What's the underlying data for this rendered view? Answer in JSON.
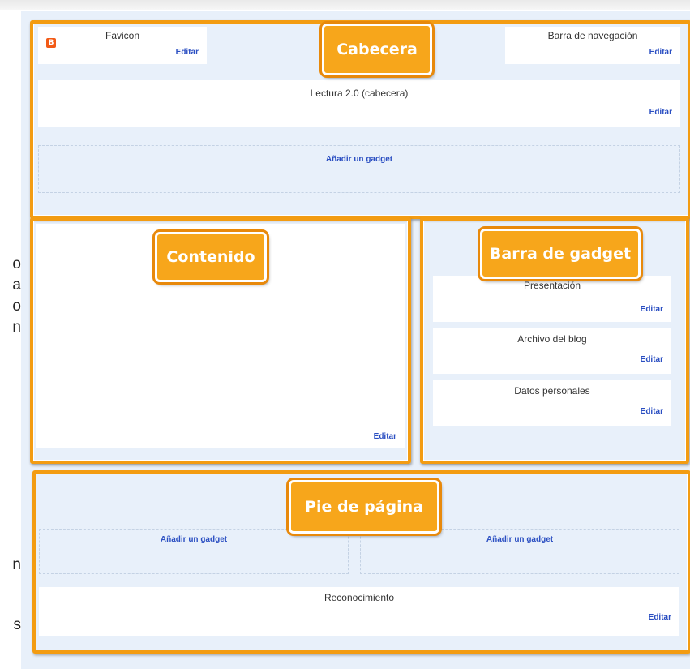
{
  "left_fragments": [
    "o",
    "a",
    "o",
    "n",
    "n",
    "s"
  ],
  "header": {
    "callout": "Cabecera",
    "favicon": {
      "title": "Favicon",
      "edit": "Editar"
    },
    "navbar": {
      "title": "Barra de navegación",
      "edit": "Editar"
    },
    "lectura": {
      "title": "Lectura 2.0 (cabecera)",
      "edit": "Editar"
    },
    "add_gadget": "Añadir un gadget"
  },
  "content": {
    "callout": "Contenido",
    "edit": "Editar"
  },
  "sidebar": {
    "callout": "Barra de gadget",
    "items": [
      {
        "title": "Presentación",
        "edit": "Editar"
      },
      {
        "title": "Archivo del blog",
        "edit": "Editar"
      },
      {
        "title": "Datos personales",
        "edit": "Editar"
      }
    ]
  },
  "footer": {
    "callout": "Pie de página",
    "add_gadget_left": "Añadir un gadget",
    "add_gadget_right": "Añadir un gadget",
    "recognition": {
      "title": "Reconocimiento",
      "edit": "Editar"
    }
  },
  "colors": {
    "accent": "#f39c12",
    "link": "#2b4fc2",
    "canvas": "#e8f0fa"
  },
  "icons": {
    "favicon": "blogger-icon"
  }
}
